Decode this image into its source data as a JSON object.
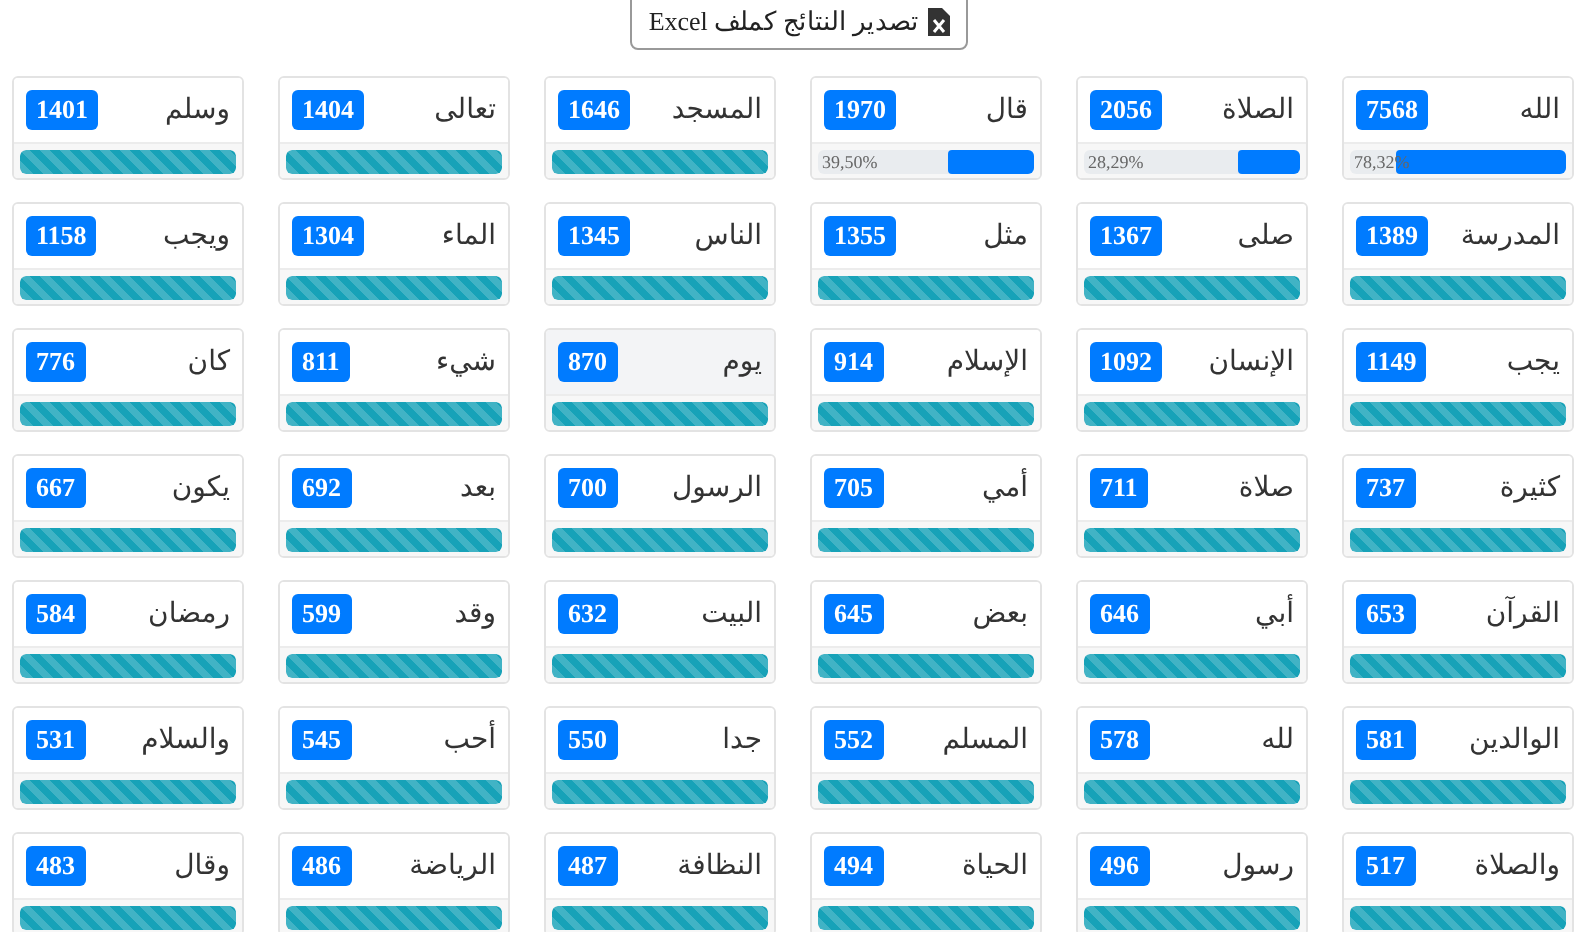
{
  "export_button": {
    "label": "تصدير النتائج كملف Excel"
  },
  "words": [
    {
      "word": "الله",
      "count": "7568",
      "kind": "percent",
      "level": 0.7832,
      "reading": "78,32%",
      "highlighted": false
    },
    {
      "word": "الصلاة",
      "count": "2056",
      "kind": "percent",
      "level": 0.2829,
      "reading": "28,29%",
      "highlighted": false
    },
    {
      "word": "قال",
      "count": "1970",
      "kind": "percent",
      "level": 0.395,
      "reading": "39,50%",
      "highlighted": false
    },
    {
      "word": "المسجد",
      "count": "1646",
      "kind": "striped",
      "level": 1,
      "highlighted": false
    },
    {
      "word": "تعالى",
      "count": "1404",
      "kind": "striped",
      "level": 1,
      "highlighted": false
    },
    {
      "word": "وسلم",
      "count": "1401",
      "kind": "striped",
      "level": 1,
      "highlighted": false
    },
    {
      "word": "المدرسة",
      "count": "1389",
      "kind": "striped",
      "level": 1,
      "highlighted": false
    },
    {
      "word": "صلى",
      "count": "1367",
      "kind": "striped",
      "level": 1,
      "highlighted": false
    },
    {
      "word": "مثل",
      "count": "1355",
      "kind": "striped",
      "level": 1,
      "highlighted": false
    },
    {
      "word": "الناس",
      "count": "1345",
      "kind": "striped",
      "level": 1,
      "highlighted": false
    },
    {
      "word": "الماء",
      "count": "1304",
      "kind": "striped",
      "level": 1,
      "highlighted": false
    },
    {
      "word": "ويجب",
      "count": "1158",
      "kind": "striped",
      "level": 1,
      "highlighted": false
    },
    {
      "word": "يجب",
      "count": "1149",
      "kind": "striped",
      "level": 1,
      "highlighted": false
    },
    {
      "word": "الإنسان",
      "count": "1092",
      "kind": "striped",
      "level": 1,
      "highlighted": false
    },
    {
      "word": "الإسلام",
      "count": "914",
      "kind": "striped",
      "level": 1,
      "highlighted": false
    },
    {
      "word": "يوم",
      "count": "870",
      "kind": "striped",
      "level": 1,
      "highlighted": true
    },
    {
      "word": "شيء",
      "count": "811",
      "kind": "striped",
      "level": 1,
      "highlighted": false
    },
    {
      "word": "كان",
      "count": "776",
      "kind": "striped",
      "level": 1,
      "highlighted": false
    },
    {
      "word": "كثيرة",
      "count": "737",
      "kind": "striped",
      "level": 1,
      "highlighted": false
    },
    {
      "word": "صلاة",
      "count": "711",
      "kind": "striped",
      "level": 1,
      "highlighted": false
    },
    {
      "word": "أمي",
      "count": "705",
      "kind": "striped",
      "level": 1,
      "highlighted": false
    },
    {
      "word": "الرسول",
      "count": "700",
      "kind": "striped",
      "level": 1,
      "highlighted": false
    },
    {
      "word": "بعد",
      "count": "692",
      "kind": "striped",
      "level": 1,
      "highlighted": false
    },
    {
      "word": "يكون",
      "count": "667",
      "kind": "striped",
      "level": 1,
      "highlighted": false
    },
    {
      "word": "القرآن",
      "count": "653",
      "kind": "striped",
      "level": 1,
      "highlighted": false
    },
    {
      "word": "أبي",
      "count": "646",
      "kind": "striped",
      "level": 1,
      "highlighted": false
    },
    {
      "word": "بعض",
      "count": "645",
      "kind": "striped",
      "level": 1,
      "highlighted": false
    },
    {
      "word": "البيت",
      "count": "632",
      "kind": "striped",
      "level": 1,
      "highlighted": false
    },
    {
      "word": "وقد",
      "count": "599",
      "kind": "striped",
      "level": 1,
      "highlighted": false
    },
    {
      "word": "رمضان",
      "count": "584",
      "kind": "striped",
      "level": 1,
      "highlighted": false
    },
    {
      "word": "الوالدين",
      "count": "581",
      "kind": "striped",
      "level": 1,
      "highlighted": false
    },
    {
      "word": "لله",
      "count": "578",
      "kind": "striped",
      "level": 1,
      "highlighted": false
    },
    {
      "word": "المسلم",
      "count": "552",
      "kind": "striped",
      "level": 1,
      "highlighted": false
    },
    {
      "word": "جدا",
      "count": "550",
      "kind": "striped",
      "level": 1,
      "highlighted": false
    },
    {
      "word": "أحب",
      "count": "545",
      "kind": "striped",
      "level": 1,
      "highlighted": false
    },
    {
      "word": "والسلام",
      "count": "531",
      "kind": "striped",
      "level": 1,
      "highlighted": false
    },
    {
      "word": "والصلاة",
      "count": "517",
      "kind": "striped",
      "level": 1,
      "highlighted": false
    },
    {
      "word": "رسول",
      "count": "496",
      "kind": "striped",
      "level": 1,
      "highlighted": false
    },
    {
      "word": "الحياة",
      "count": "494",
      "kind": "striped",
      "level": 1,
      "highlighted": false
    },
    {
      "word": "النظافة",
      "count": "487",
      "kind": "striped",
      "level": 1,
      "highlighted": false
    },
    {
      "word": "الرياضة",
      "count": "486",
      "kind": "striped",
      "level": 1,
      "highlighted": false
    },
    {
      "word": "وقال",
      "count": "483",
      "kind": "striped",
      "level": 1,
      "highlighted": false
    }
  ]
}
